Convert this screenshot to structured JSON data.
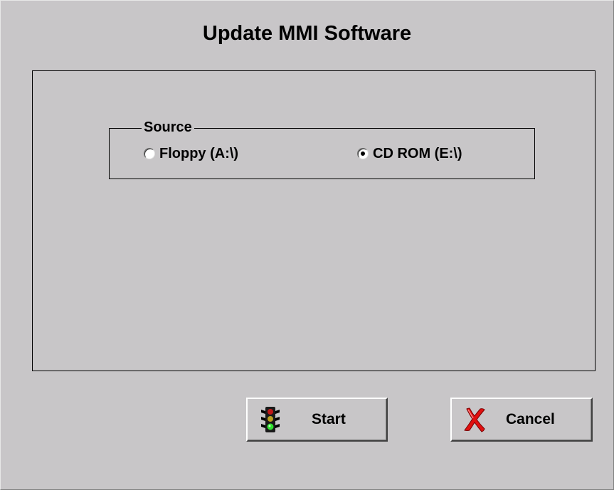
{
  "dialog": {
    "title": "Update MMI Software"
  },
  "source_group": {
    "legend": "Source",
    "options": [
      {
        "label": "Floppy (A:\\)",
        "selected": false
      },
      {
        "label": "CD ROM (E:\\)",
        "selected": true
      }
    ]
  },
  "buttons": {
    "start_label": "Start",
    "start_icon": "traffic-light-icon",
    "cancel_label": "Cancel",
    "cancel_icon": "red-x-icon"
  },
  "colors": {
    "background": "#c8c6c8",
    "cancel_x": "#e01010"
  }
}
